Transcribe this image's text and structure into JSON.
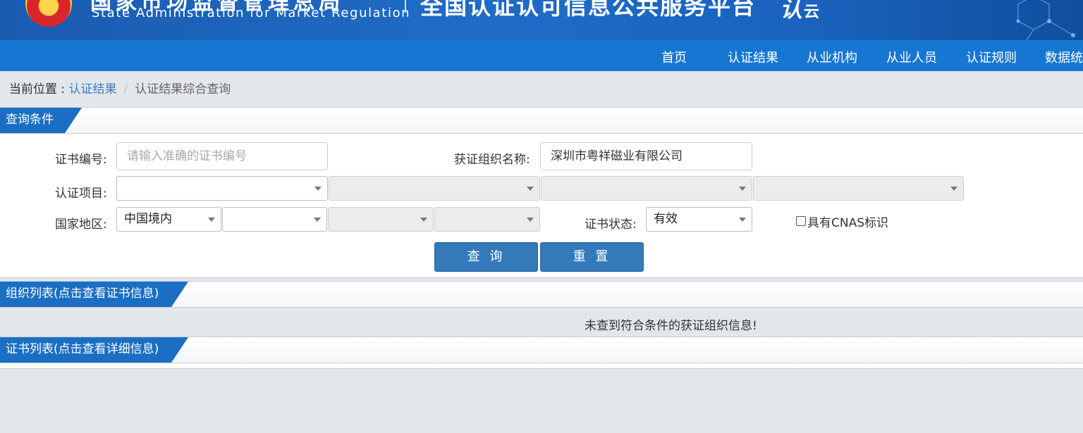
{
  "header": {
    "org_cn": "国家市场监督管理总局",
    "org_en": "State Administration  for  Market Regulation",
    "platform_title": "全国认证认可信息公共服务平台",
    "platform_logo": "认",
    "platform_logo_sub": "云"
  },
  "nav": {
    "items": [
      "首页",
      "认证结果",
      "从业机构",
      "从业人员",
      "认证规则",
      "数据统"
    ]
  },
  "breadcrumb": {
    "prefix": "当前位置 : ",
    "link": "认证结果",
    "separator": "/",
    "current": "认证结果综合查询"
  },
  "query_section": {
    "title": "查询条件",
    "cert_no_label": "证书编号:",
    "cert_no_placeholder": "请输入准确的证书编号",
    "org_name_label": "获证组织名称:",
    "org_name_value": "深圳市粤祥磁业有限公司",
    "project_label": "认证项目:",
    "project_selects": [
      "",
      "",
      "",
      ""
    ],
    "region_label": "国家地区:",
    "region_selects": [
      "中国境内",
      "",
      "",
      ""
    ],
    "status_label": "证书状态:",
    "status_value": "有效",
    "cnas_label": "具有CNAS标识",
    "search_button": "查 询",
    "reset_button": "重 置"
  },
  "org_list": {
    "title": "组织列表(点击查看证书信息)",
    "empty_message": "未查到符合条件的获证组织信息!"
  },
  "cert_list": {
    "title": "证书列表(点击查看详细信息)"
  },
  "colors": {
    "banner": "#1f6cc7",
    "nav": "#1677d2",
    "section_tab": "#1a6fc4",
    "button": "#3479ba",
    "background": "#e3e6ea"
  }
}
